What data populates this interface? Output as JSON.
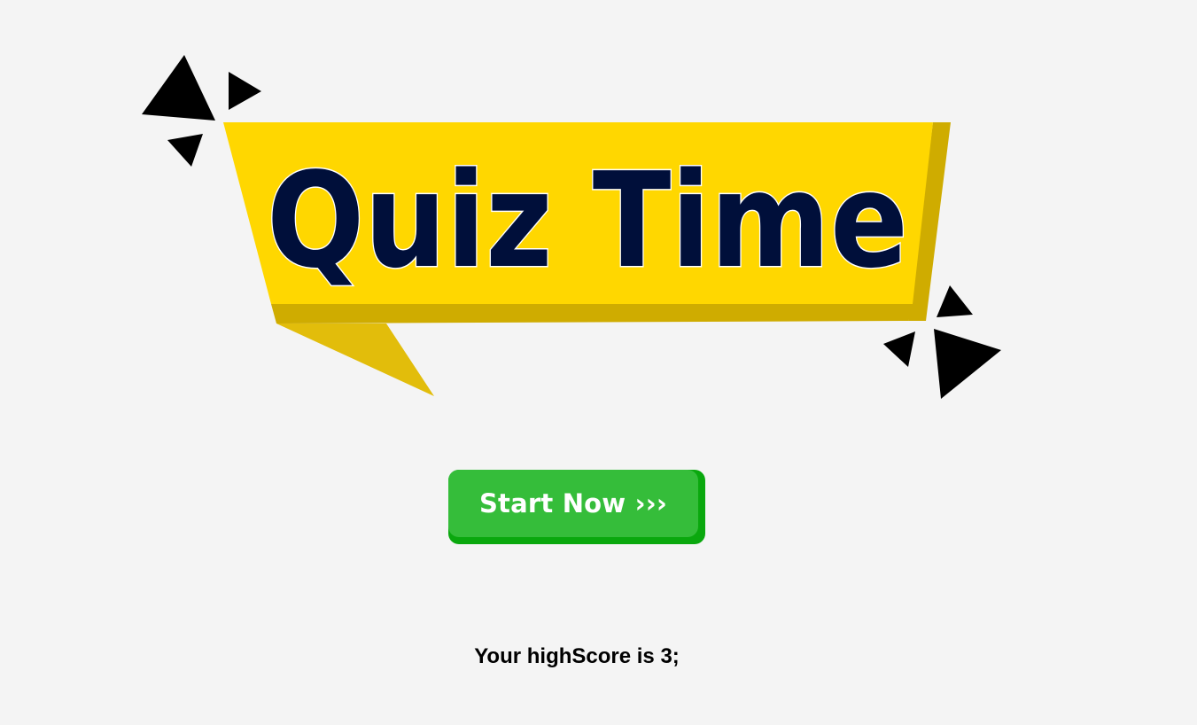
{
  "banner": {
    "title": "Quiz Time",
    "colors": {
      "ribbon": "#ffd700",
      "ribbon_shade": "#cfac00",
      "ribbon_tail": "#e2bd0b",
      "title_text": "#000f3a",
      "title_outline": "#ffffff",
      "confetti": "#000000"
    }
  },
  "start": {
    "label": "Start Now ›››",
    "colors": {
      "face": "#35bd3a",
      "shadow": "#0aa80e",
      "text": "#ffffff"
    }
  },
  "highscore": {
    "text": "Your highScore is 3;"
  }
}
